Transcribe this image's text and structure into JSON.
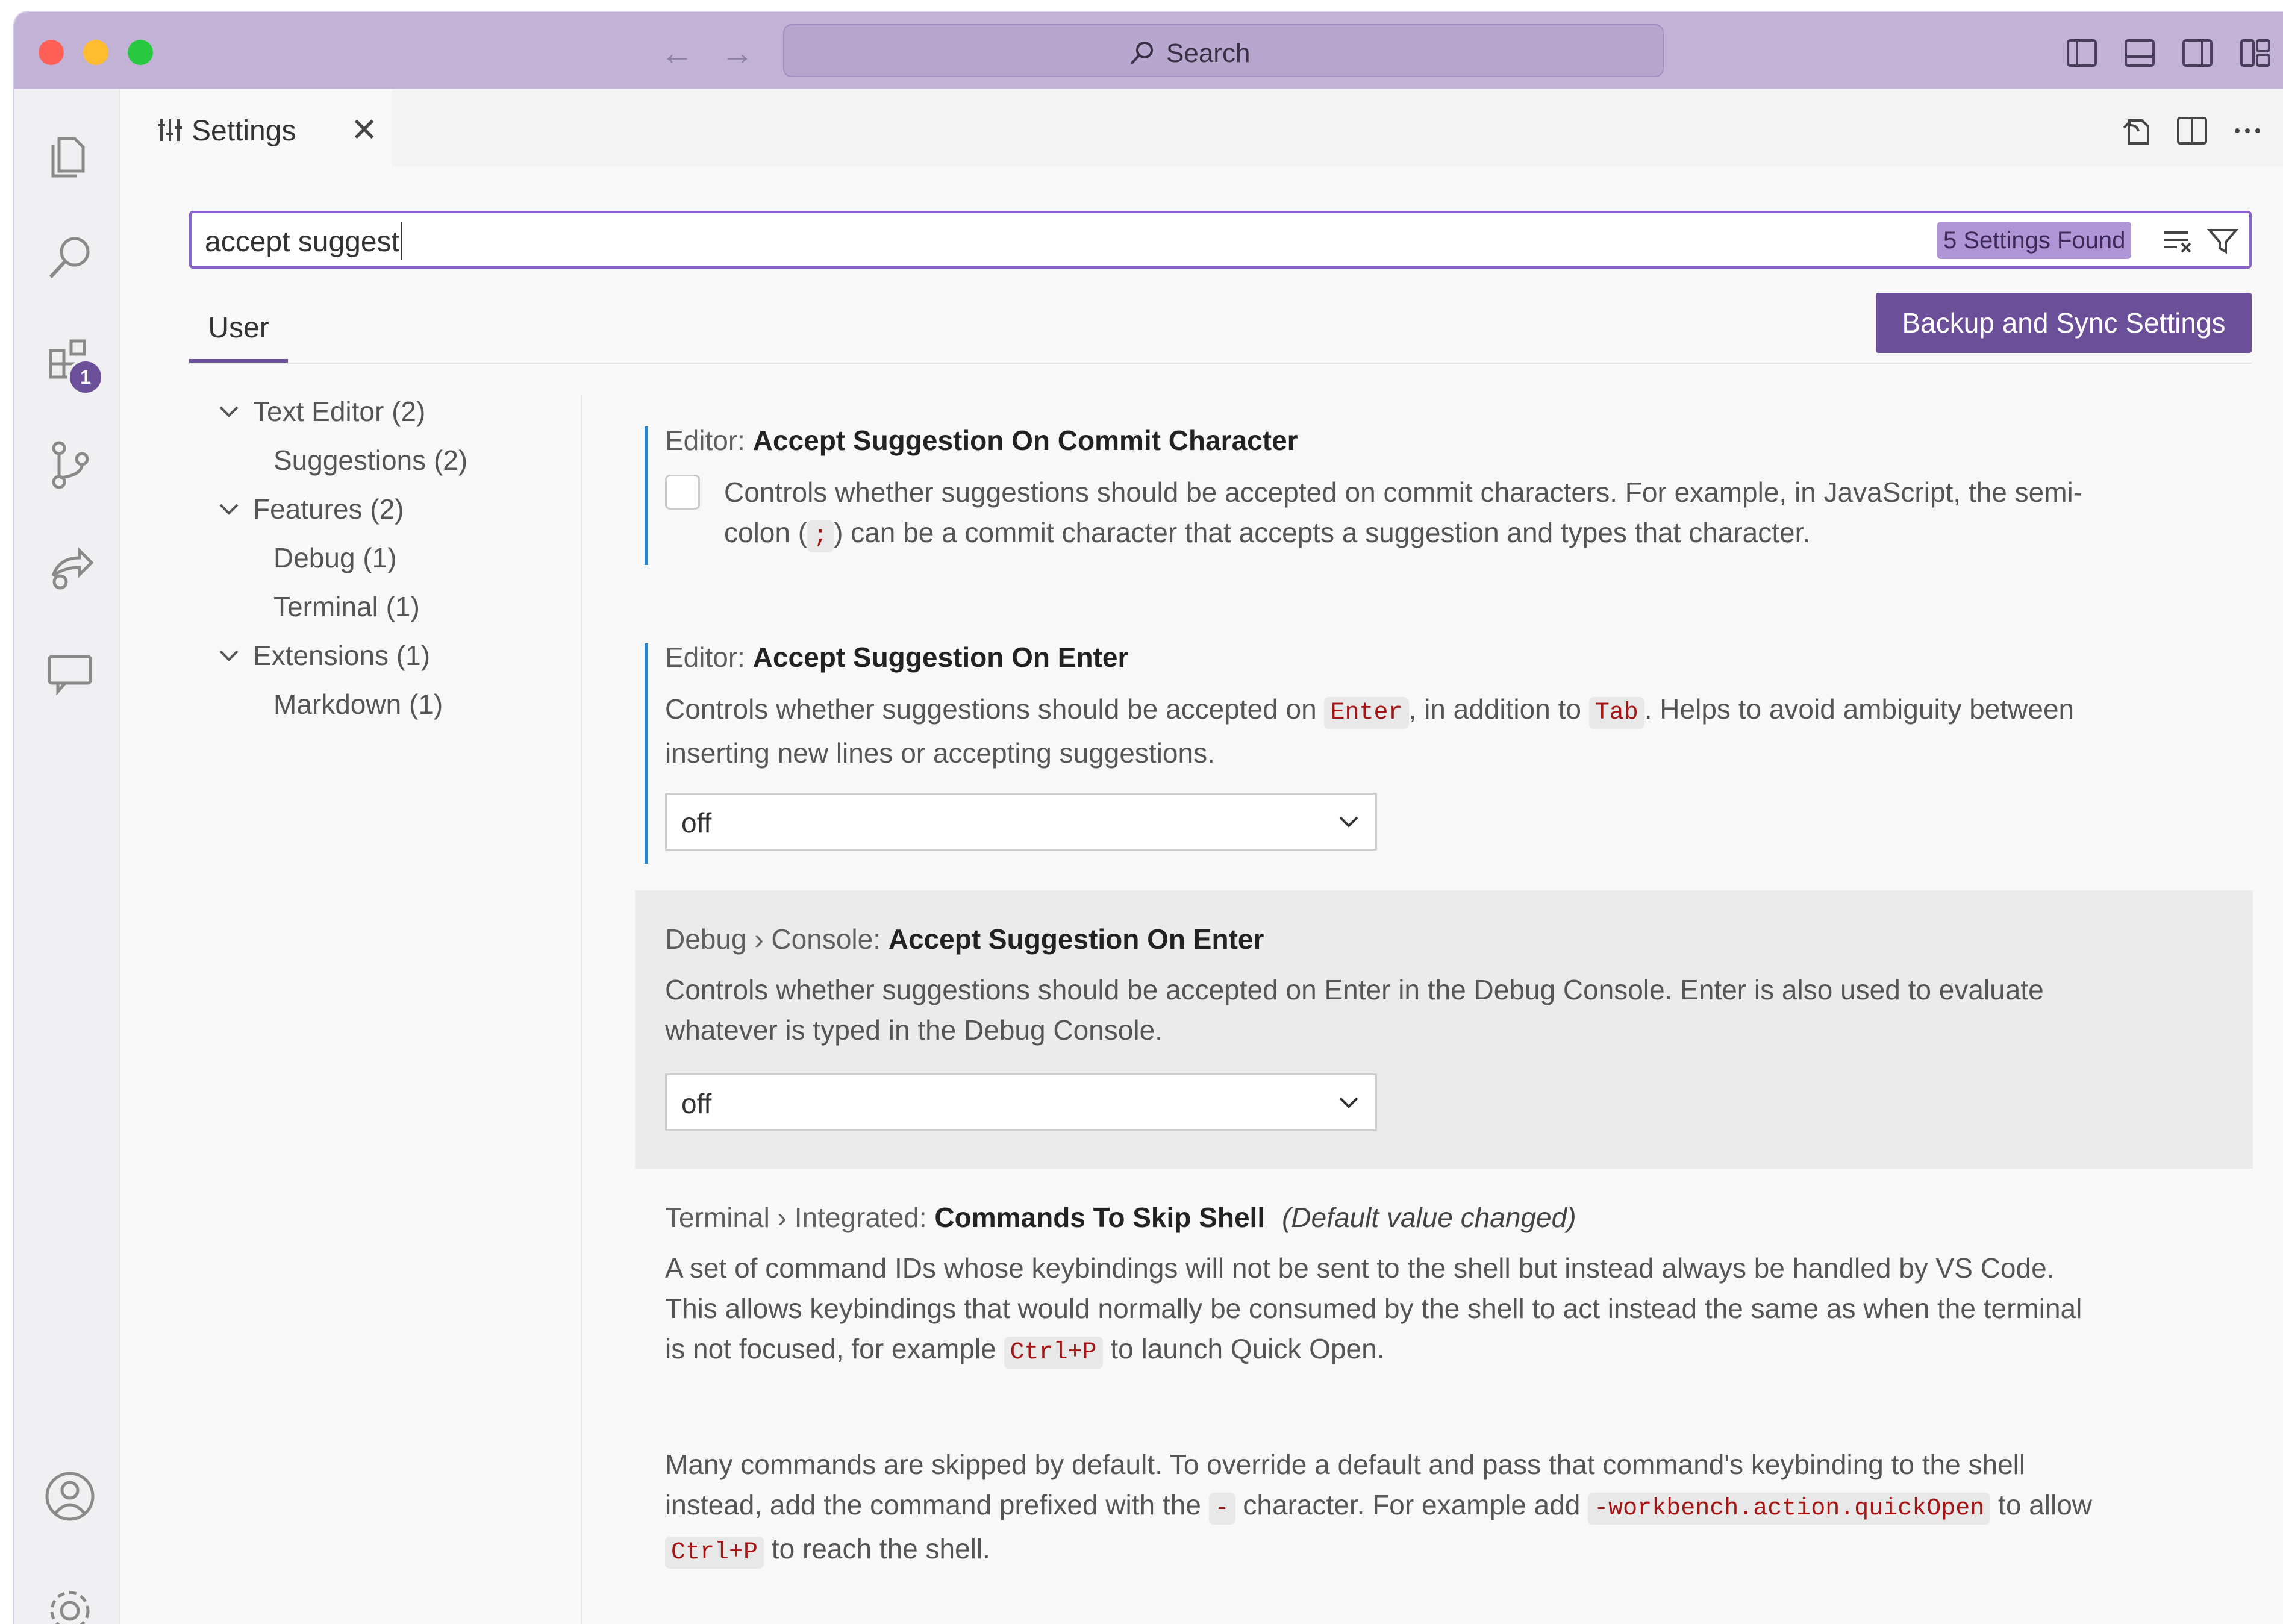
{
  "window": {
    "search_label": "Search"
  },
  "activity_bar": {
    "items": [
      "explorer-icon",
      "search-icon",
      "extensions-icon",
      "source-control-icon",
      "run-debug-icon",
      "remote-explorer-icon"
    ],
    "extensions_badge": "1",
    "bottom": [
      "accounts-icon",
      "manage-gear-icon"
    ]
  },
  "tab": {
    "label": "Settings",
    "close": "✕"
  },
  "search": {
    "query": "accept suggest",
    "found_badge": "5 Settings Found"
  },
  "scope": {
    "user_tab": "User",
    "sync_button": "Backup and Sync Settings"
  },
  "toc": [
    {
      "label": "Text Editor (2)",
      "level": 0,
      "expanded": true
    },
    {
      "label": "Suggestions (2)",
      "level": 1
    },
    {
      "label": "Features (2)",
      "level": 0,
      "expanded": true
    },
    {
      "label": "Debug (1)",
      "level": 1
    },
    {
      "label": "Terminal (1)",
      "level": 1
    },
    {
      "label": "Extensions (1)",
      "level": 0,
      "expanded": true
    },
    {
      "label": "Markdown (1)",
      "level": 1
    }
  ],
  "settings": [
    {
      "category": "Editor: ",
      "name": "Accept Suggestion On Commit Character",
      "desc_1": "Controls whether suggestions should be accepted on commit characters. For example, in JavaScript, the semi-",
      "desc_2a": "colon (",
      "code": ";",
      "desc_2b": ") can be a commit character that accepts a suggestion and types that character.",
      "checked": false
    },
    {
      "category": "Editor: ",
      "name": "Accept Suggestion On Enter",
      "desc_a": "Controls whether suggestions should be accepted on ",
      "code_1": "Enter",
      "desc_b": ", in addition to ",
      "code_2": "Tab",
      "desc_c": ". Helps to avoid ambiguity between",
      "desc_d": "inserting new lines or accepting suggestions.",
      "value": "off"
    },
    {
      "category": "Debug › Console: ",
      "name": "Accept Suggestion On Enter",
      "desc_1": "Controls whether suggestions should be accepted on Enter in the Debug Console. Enter is also used to evaluate",
      "desc_2": "whatever is typed in the Debug Console.",
      "value": "off"
    },
    {
      "category": "Terminal › Integrated: ",
      "name": "Commands To Skip Shell",
      "modified": "(Default value changed)",
      "p1_l1": "A set of command IDs whose keybindings will not be sent to the shell but instead always be handled by VS Code.",
      "p1_l2": "This allows keybindings that would normally be consumed by the shell to act instead the same as when the terminal",
      "p1_l3a": "is not focused, for example ",
      "p1_code": "Ctrl+P",
      "p1_l3b": " to launch Quick Open.",
      "p2_l1": "Many commands are skipped by default. To override a default and pass that command's keybinding to the shell",
      "p2_l2a": "instead, add the command prefixed with the ",
      "p2_code1": "-",
      "p2_l2b": " character. For example add ",
      "p2_code2": "-workbench.action.quickOpen",
      "p2_l2c": " to allow",
      "p2_code3": "Ctrl+P",
      "p2_l3": " to reach the shell."
    }
  ]
}
